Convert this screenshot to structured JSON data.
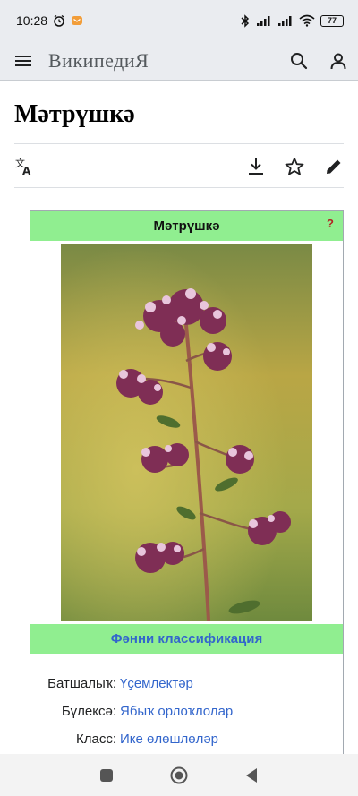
{
  "status": {
    "time": "10:28",
    "battery": "77"
  },
  "app": {
    "title": "ВикипедиЯ"
  },
  "article": {
    "title": "Мәтрүшкә"
  },
  "infobox": {
    "title": "Мәтрүшкә",
    "help": "?",
    "classification_header": "Фәнни классификация",
    "rows": [
      {
        "label": "Батшалыҡ:",
        "value": "Үҫемлектәр"
      },
      {
        "label": "Бүлексә:",
        "value": "Ябыҡ орлоҡлолар"
      },
      {
        "label": "Класс:",
        "value": "Ике өлөшлөләр"
      }
    ]
  },
  "colors": {
    "infobox_header": "#90ee90",
    "link": "#3366cc",
    "chrome": "#eaecf0"
  }
}
